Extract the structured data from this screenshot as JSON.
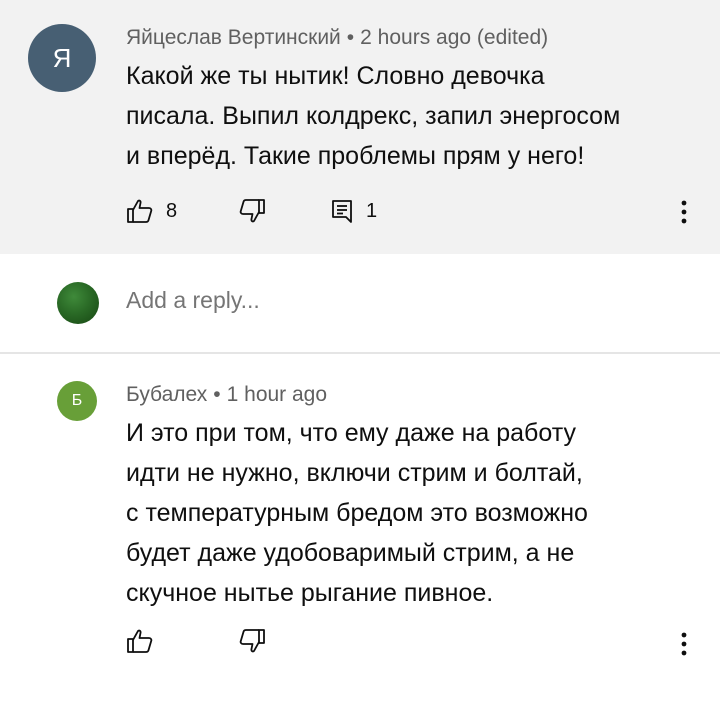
{
  "comments": [
    {
      "avatar_letter": "Я",
      "author": "Яйцеслав Вертинский",
      "time": "2 hours ago",
      "edited": "(edited)",
      "text": "Какой же ты нытик! Словно девочка\nписала. Выпил колдрекс, запил энергосом\nи вперёд. Такие проблемы прям у него!",
      "likes": "8",
      "replies": "1",
      "avatar_color": "#475f73"
    },
    {
      "avatar_letter": "Б",
      "author": "Бубалех",
      "time": "1 hour ago",
      "text": "И это при том, что ему даже на работу\nидти не нужно, включи стрим и болтай,\nс температурным бредом это возможно\nбудет даже удобоваримый стрим, а не\nскучное нытье рыгание пивное.",
      "avatar_color": "#689f38"
    }
  ],
  "reply_box": {
    "placeholder": "Add a reply..."
  },
  "icons": {
    "like": "thumb-up-icon",
    "dislike": "thumb-down-icon",
    "reply": "comment-icon",
    "more": "more-vert-icon"
  }
}
